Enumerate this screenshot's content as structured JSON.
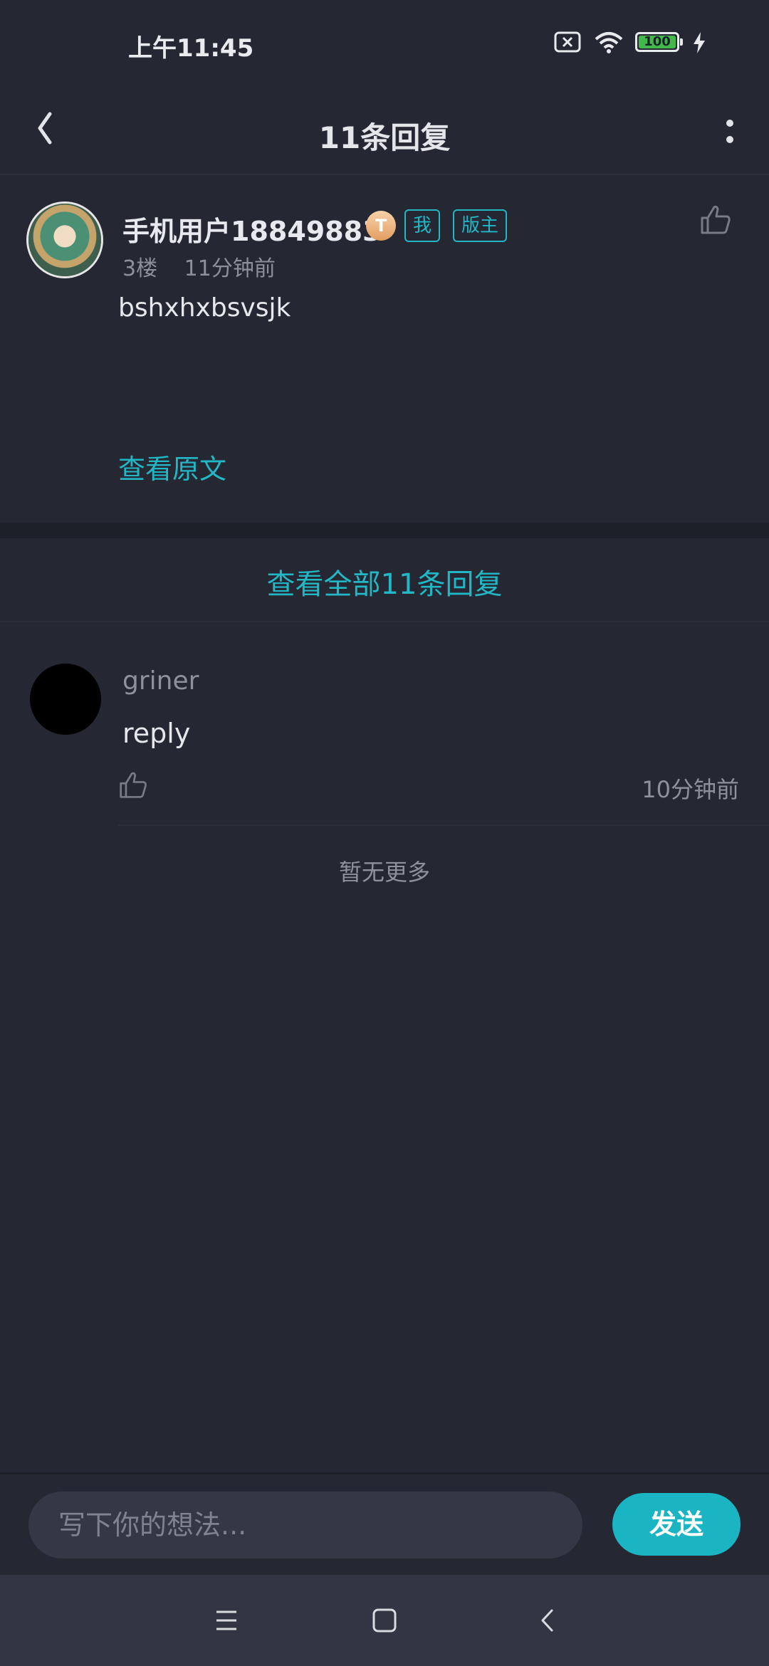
{
  "status_bar": {
    "time": "上午11:45",
    "battery": "100",
    "icons": [
      "sim-card-icon",
      "wifi-icon",
      "battery-icon",
      "charging-icon"
    ]
  },
  "header": {
    "title": "11条回复",
    "back_icon": "chevron-left-icon",
    "more_icon": "more-vertical-icon"
  },
  "post": {
    "username": "手机用户18849883",
    "level_badge": "T",
    "tags": [
      "我",
      "版主"
    ],
    "floor": "3楼",
    "time": "11分钟前",
    "content": "bshxhxbsvsjk",
    "view_original": "查看原文"
  },
  "replies_summary": {
    "label": "查看全部11条回复"
  },
  "reply": {
    "name": "griner",
    "text": "reply",
    "time": "10分钟前"
  },
  "list_end": {
    "label": "暂无更多"
  },
  "composer": {
    "placeholder": "写下你的想法...",
    "send_label": "发送"
  },
  "colors": {
    "accent": "#21b7c4",
    "background": "#252733",
    "secondary_text": "#8e919b"
  }
}
